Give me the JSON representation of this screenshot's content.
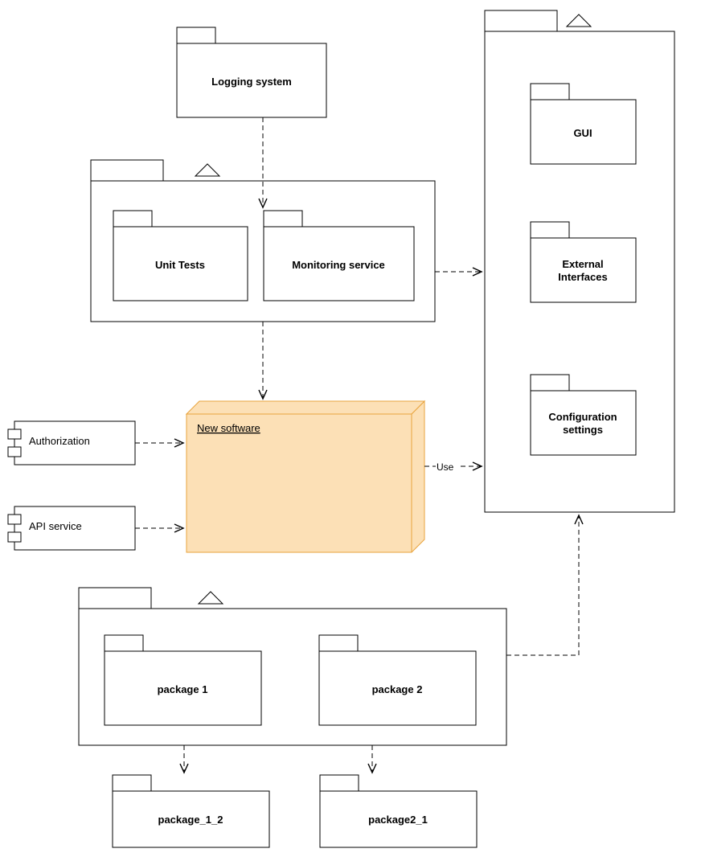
{
  "packages": {
    "logging": "Logging system",
    "unitTests": "Unit Tests",
    "monitoring": "Monitoring service",
    "gui": "GUI",
    "externalInterfaces1": "External",
    "externalInterfaces2": "Interfaces",
    "configSettings1": "Configuration",
    "configSettings2": "settings",
    "package1": "package 1",
    "package2": "package 2",
    "package1_2": "package_1_2",
    "package2_1": "package2_1"
  },
  "components": {
    "authorization": "Authorization",
    "apiService": "API service"
  },
  "node": {
    "newSoftware": "New software"
  },
  "labels": {
    "use": "Use"
  },
  "colors": {
    "nodeFill": "#FCE0B6",
    "nodeStroke": "#E8A33D",
    "line": "#000"
  }
}
